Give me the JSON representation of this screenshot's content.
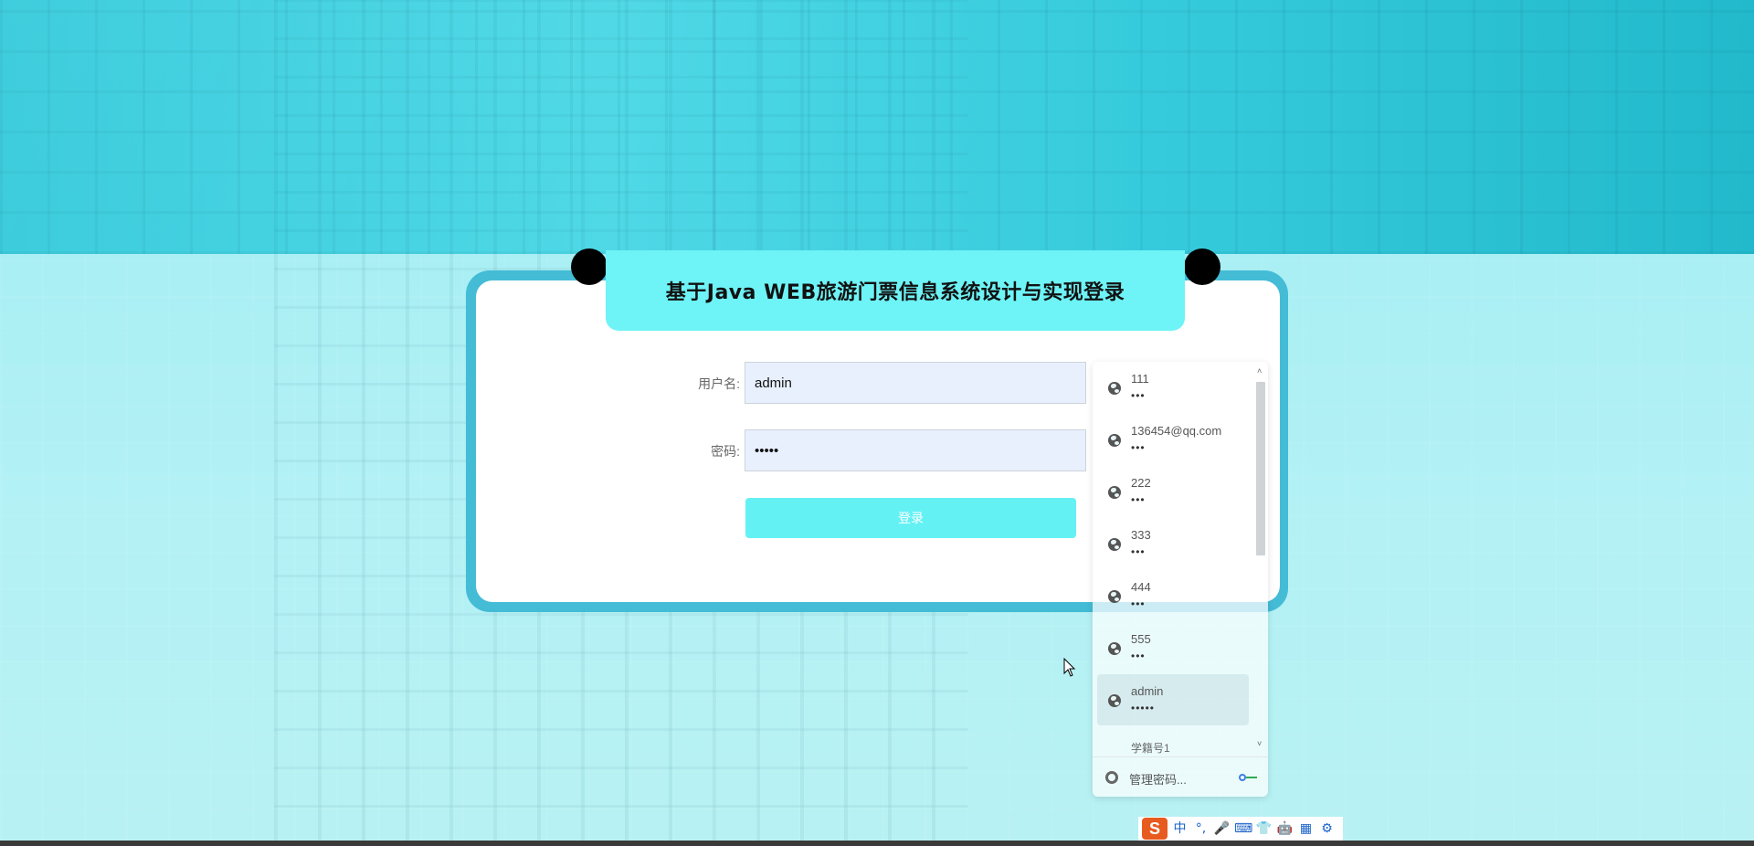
{
  "page": {
    "title": "基于Java WEB旅游门票信息系统设计与实现登录"
  },
  "form": {
    "username_label": "用户名:",
    "username_value": "admin",
    "password_label": "密码:",
    "password_value": "•••••",
    "login_button": "登录"
  },
  "autofill": {
    "items": [
      {
        "user": "111",
        "pass": "•••"
      },
      {
        "user": "136454@qq.com",
        "pass": "•••"
      },
      {
        "user": "222",
        "pass": "•••"
      },
      {
        "user": "333",
        "pass": "•••"
      },
      {
        "user": "444",
        "pass": "•••"
      },
      {
        "user": "555",
        "pass": "•••"
      },
      {
        "user": "admin",
        "pass": "•••••"
      }
    ],
    "partial_item": "学籍号1",
    "footer_label": "管理密码...",
    "scroll_up_glyph": "˄",
    "scroll_down_glyph": "˅"
  },
  "ime": {
    "logo": "S",
    "cells": [
      "中",
      "°,",
      "🎤",
      "⌨",
      "👕",
      "🤖",
      "▦",
      "⚙"
    ]
  },
  "colors": {
    "card_frame": "#44bcd6",
    "title_tab": "#6ef3f6",
    "login_button": "#64f1f4",
    "input_bg": "#e8f0fe"
  }
}
